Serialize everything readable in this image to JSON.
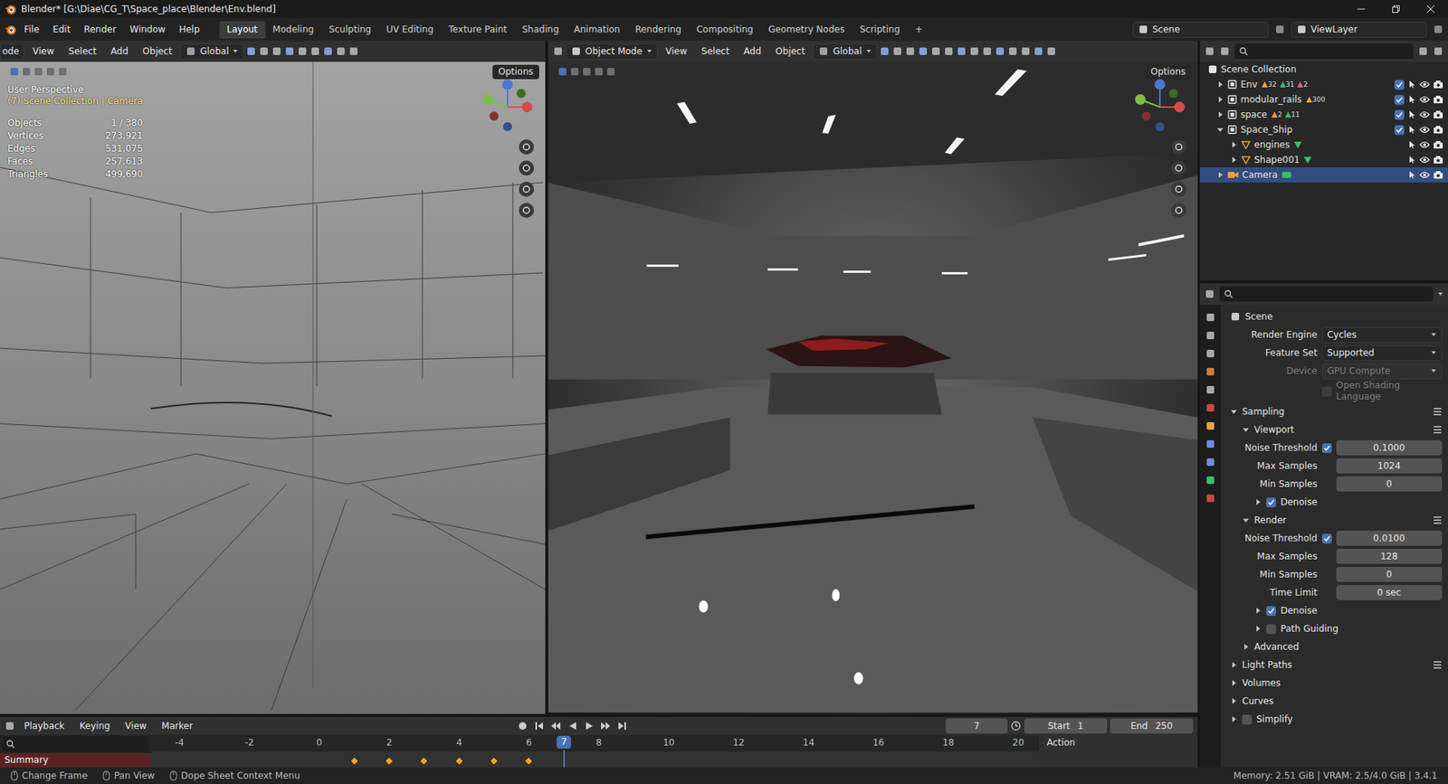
{
  "window": {
    "title": "Blender* [G:\\Diae\\CG_T\\Space_place\\Blender\\Env.blend]"
  },
  "menu": [
    "File",
    "Edit",
    "Render",
    "Window",
    "Help"
  ],
  "workspaces": [
    {
      "label": "Layout",
      "selected": true
    },
    {
      "label": "Modeling",
      "selected": false
    },
    {
      "label": "Sculpting",
      "selected": false
    },
    {
      "label": "UV Editing",
      "selected": false
    },
    {
      "label": "Texture Paint",
      "selected": false
    },
    {
      "label": "Shading",
      "selected": false
    },
    {
      "label": "Animation",
      "selected": false
    },
    {
      "label": "Rendering",
      "selected": false
    },
    {
      "label": "Compositing",
      "selected": false
    },
    {
      "label": "Geometry Nodes",
      "selected": false
    },
    {
      "label": "Scripting",
      "selected": false
    }
  ],
  "add_workspace": "+",
  "scene": "Scene",
  "view_layer": "ViewLayer",
  "viewport_left": {
    "menu": [
      "ode",
      "View",
      "Select",
      "Add",
      "Object"
    ],
    "orientation": "Global",
    "options": "Options",
    "perspective": "User Perspective",
    "context": "(7) Scene Collection | Camera",
    "stats": [
      {
        "label": "Objects",
        "value": "1 / 380"
      },
      {
        "label": "Vertices",
        "value": "273,921"
      },
      {
        "label": "Edges",
        "value": "531,075"
      },
      {
        "label": "Faces",
        "value": "257,613"
      },
      {
        "label": "Triangles",
        "value": "499,690"
      }
    ]
  },
  "viewport_right": {
    "mode": "Object Mode",
    "menu": [
      "View",
      "Select",
      "Add",
      "Object"
    ],
    "orientation": "Global",
    "options": "Options"
  },
  "outliner": {
    "root": "Scene Collection",
    "items": [
      {
        "name": "Env",
        "depth": 0,
        "kind": "collection",
        "expanded": false,
        "counts": [
          "32",
          "31",
          "2"
        ],
        "included": true,
        "selected": false
      },
      {
        "name": "modular_rails",
        "depth": 0,
        "kind": "collection",
        "expanded": false,
        "counts": [
          "300"
        ],
        "included": true,
        "selected": false
      },
      {
        "name": "space",
        "depth": 0,
        "kind": "collection",
        "expanded": false,
        "counts": [
          "2",
          "11"
        ],
        "included": true,
        "selected": false
      },
      {
        "name": "Space_Ship",
        "depth": 0,
        "kind": "collection",
        "expanded": true,
        "counts": [],
        "included": true,
        "selected": false
      },
      {
        "name": "engines",
        "depth": 1,
        "kind": "mesh",
        "expanded": false,
        "counts": [],
        "selected": false
      },
      {
        "name": "Shape001",
        "depth": 1,
        "kind": "mesh",
        "expanded": false,
        "counts": [],
        "selected": false
      },
      {
        "name": "Camera",
        "depth": 0,
        "kind": "camera",
        "expanded": false,
        "counts": [],
        "selected": true
      }
    ]
  },
  "properties": {
    "title": "Scene",
    "rows": [
      {
        "kind": "select",
        "label": "Render Engine",
        "value": "Cycles",
        "disabled": false
      },
      {
        "kind": "select",
        "label": "Feature Set",
        "value": "Supported",
        "disabled": false
      },
      {
        "kind": "select",
        "label": "Device",
        "value": "GPU Compute",
        "disabled": true
      },
      {
        "kind": "checkbox",
        "label": "Open Shading Language",
        "checked": false,
        "disabled": true
      },
      {
        "kind": "panel",
        "label": "Sampling",
        "expanded": true,
        "depth": 0
      },
      {
        "kind": "panel",
        "label": "Viewport",
        "expanded": true,
        "depth": 1
      },
      {
        "kind": "number",
        "label": "Noise Threshold",
        "value": "0.1000",
        "checked": true
      },
      {
        "kind": "number",
        "label": "Max Samples",
        "value": "1024"
      },
      {
        "kind": "number",
        "label": "Min Samples",
        "value": "0"
      },
      {
        "kind": "panel",
        "label": "Denoise",
        "expanded": false,
        "depth": 2,
        "checked": true
      },
      {
        "kind": "panel",
        "label": "Render",
        "expanded": true,
        "depth": 1
      },
      {
        "kind": "number",
        "label": "Noise Threshold",
        "value": "0.0100",
        "checked": true
      },
      {
        "kind": "number",
        "label": "Max Samples",
        "value": "128"
      },
      {
        "kind": "number",
        "label": "Min Samples",
        "value": "0"
      },
      {
        "kind": "number",
        "label": "Time Limit",
        "value": "0 sec"
      },
      {
        "kind": "panel",
        "label": "Denoise",
        "expanded": false,
        "depth": 2,
        "checked": true
      },
      {
        "kind": "panel",
        "label": "Path Guiding",
        "expanded": false,
        "depth": 2,
        "checked": false
      },
      {
        "kind": "panel",
        "label": "Advanced",
        "expanded": false,
        "depth": 1
      },
      {
        "kind": "panel",
        "label": "Light Paths",
        "expanded": false,
        "depth": 0
      },
      {
        "kind": "panel",
        "label": "Volumes",
        "expanded": false,
        "depth": 0
      },
      {
        "kind": "panel",
        "label": "Curves",
        "expanded": false,
        "depth": 0
      },
      {
        "kind": "panel",
        "label": "Simplify",
        "expanded": false,
        "depth": 0,
        "checked": false
      }
    ]
  },
  "timeline": {
    "menu": [
      "Playback",
      "Keying",
      "View",
      "Marker"
    ],
    "current_frame": "7",
    "start_label": "Start",
    "start": "1",
    "end_label": "End",
    "end": "250",
    "ruler": [
      "-4",
      "-2",
      "0",
      "2",
      "4",
      "6",
      "8",
      "10",
      "12",
      "14",
      "16",
      "18",
      "20"
    ],
    "keyframes": [
      1,
      2,
      3,
      4,
      5,
      6
    ],
    "summary": "Summary",
    "action": "Action"
  },
  "status_bar": {
    "hints": [
      "Change Frame",
      "Pan View",
      "Dope Sheet Context Menu"
    ],
    "info": "Memory: 2.51 GiB | VRAM: 2.5/4.0 GiB | 3.4.1"
  }
}
